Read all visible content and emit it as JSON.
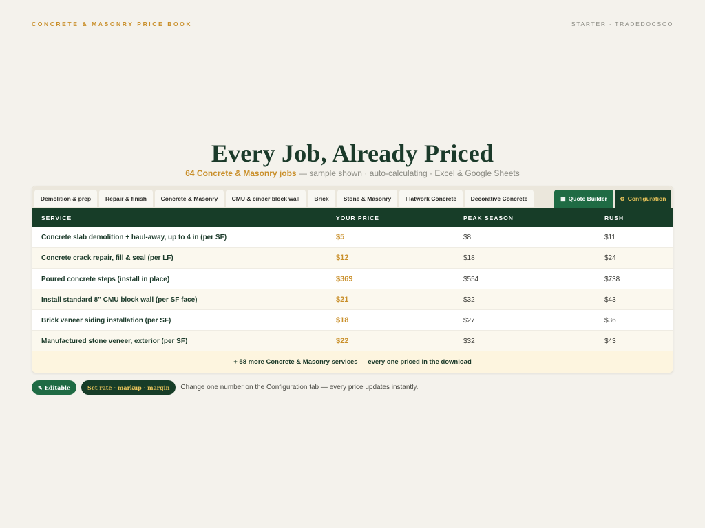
{
  "header": {
    "brand": "CONCRETE & MASONRY PRICE BOOK",
    "plan": "STARTER · TRADEDOCSCO"
  },
  "hero": {
    "title": "Every Job, Already Priced",
    "subtitle_accent": "64 Concrete & Masonry jobs",
    "subtitle_rest": " — sample shown · auto-calculating · Excel & Google Sheets"
  },
  "tabs": [
    {
      "label": "Demolition & prep"
    },
    {
      "label": "Repair & finish"
    },
    {
      "label": "Concrete & Masonry"
    },
    {
      "label": "CMU & cinder block wall"
    },
    {
      "label": "Brick"
    },
    {
      "label": "Stone & Masonry"
    },
    {
      "label": "Flatwork Concrete"
    },
    {
      "label": "Decorative Concrete"
    }
  ],
  "action_tabs": {
    "quote_builder": {
      "icon": "clipboard-icon",
      "glyph": "▦",
      "label": "Quote Builder"
    },
    "configuration": {
      "icon": "gear-icon",
      "glyph": "⚙",
      "label": "Configuration"
    }
  },
  "table": {
    "columns": [
      "SERVICE",
      "YOUR PRICE",
      "PEAK SEASON",
      "RUSH"
    ],
    "rows": [
      {
        "service": "Concrete slab demolition + haul-away, up to 4 in (per SF)",
        "price": "$5",
        "peak": "$8",
        "rush": "$11"
      },
      {
        "service": "Concrete crack repair, fill & seal (per LF)",
        "price": "$12",
        "peak": "$18",
        "rush": "$24"
      },
      {
        "service": "Poured concrete steps (install in place)",
        "price": "$369",
        "peak": "$554",
        "rush": "$738"
      },
      {
        "service": "Install standard 8\" CMU block wall (per SF face)",
        "price": "$21",
        "peak": "$32",
        "rush": "$43"
      },
      {
        "service": "Brick veneer siding installation (per SF)",
        "price": "$18",
        "peak": "$27",
        "rush": "$36"
      },
      {
        "service": "Manufactured stone veneer, exterior (per SF)",
        "price": "$22",
        "peak": "$32",
        "rush": "$43"
      }
    ],
    "more": "+ 58 more Concrete & Masonry services — every one priced in the download"
  },
  "footer": {
    "editable_glyph": "✎",
    "editable_label": "Editable",
    "config_pill": "Set rate · markup · margin",
    "note": "Change one number on the Configuration tab — every price updates instantly."
  },
  "colors": {
    "background": "#f4f2ec",
    "dark_green": "#173d28",
    "green": "#1f6b44",
    "gold": "#c98f2a"
  }
}
